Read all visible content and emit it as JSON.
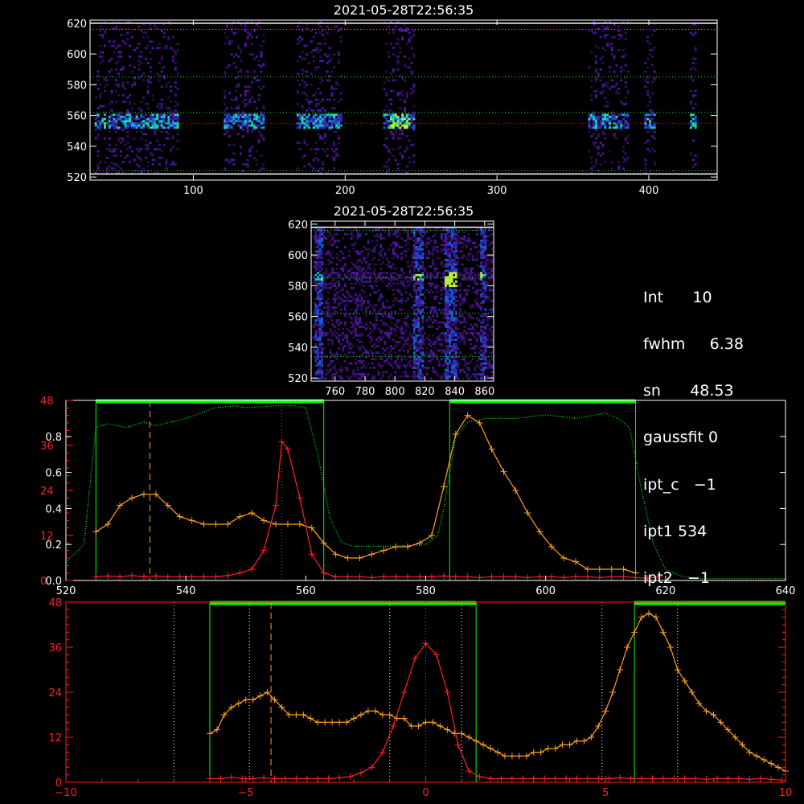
{
  "chart_data": [
    {
      "type": "heatmap",
      "title": "2021-05-28T22:56:35",
      "xlim": [
        32,
        445
      ],
      "ylim": [
        518,
        622
      ],
      "x_ticks": [
        100,
        200,
        300,
        400
      ],
      "y_ticks": [
        520,
        540,
        560,
        580,
        600,
        620
      ],
      "colors": {
        "frame": "#ffffff",
        "hline_dotted": "#00ff00",
        "hline_center": "#ff0000"
      },
      "hlines": [
        616,
        585,
        562,
        555,
        524
      ],
      "columns": [
        [
          35,
          90
        ],
        [
          120,
          147
        ],
        [
          168,
          197
        ],
        [
          225,
          245
        ],
        [
          360,
          387
        ],
        [
          397,
          404
        ],
        [
          427,
          431
        ]
      ]
    },
    {
      "type": "heatmap",
      "title": "2021-05-28T22:56:35",
      "xlim": [
        744,
        866
      ],
      "ylim": [
        518,
        622
      ],
      "x_ticks": [
        760,
        780,
        800,
        820,
        840,
        860
      ],
      "y_ticks": [
        520,
        540,
        560,
        580,
        600,
        620
      ],
      "hlines": [
        616,
        585,
        562,
        534
      ]
    },
    {
      "type": "line",
      "xlim": [
        520,
        640
      ],
      "ylim": [
        0,
        1
      ],
      "y2lim": [
        0,
        48
      ],
      "x_ticks": [
        520,
        540,
        560,
        580,
        600,
        620,
        640
      ],
      "y_ticks": [
        0.0,
        0.2,
        0.4,
        0.6,
        0.8
      ],
      "y_tick_labels": [
        "0.0",
        "0.2",
        "0.4",
        "0.6",
        "0.8"
      ],
      "y2_ticks": [
        0,
        12,
        24,
        36,
        48
      ],
      "windows": [
        [
          525,
          563
        ],
        [
          584,
          615
        ]
      ],
      "vlines": [
        534,
        556
      ],
      "series": [
        {
          "color": "#ff2020",
          "x": [
            525,
            527,
            529,
            531,
            533,
            535,
            537,
            539,
            541,
            543,
            545,
            547,
            549,
            551,
            553,
            555,
            556,
            557,
            559,
            561,
            563,
            565,
            567,
            569,
            571,
            573,
            575,
            577,
            579,
            581,
            583,
            585,
            587,
            589,
            591,
            593,
            595,
            597,
            599,
            601,
            603,
            605,
            607,
            609,
            611,
            613,
            615,
            617,
            619
          ],
          "y": [
            1,
            1.2,
            1,
            1.3,
            1,
            1.2,
            1,
            1,
            1,
            1,
            1,
            1.3,
            2,
            3,
            8,
            20,
            37,
            35,
            22,
            7,
            2,
            1,
            1,
            1,
            0.8,
            1,
            1,
            1,
            1,
            1,
            1.2,
            1,
            1,
            0.8,
            1,
            1,
            1,
            0.8,
            1,
            1,
            0.8,
            1,
            1,
            0.8,
            1,
            1,
            0.8,
            0.6,
            1
          ]
        },
        {
          "color": "#ffa020",
          "x": [
            525,
            527,
            529,
            531,
            533,
            535,
            537,
            539,
            541,
            543,
            545,
            547,
            549,
            551,
            553,
            555,
            557,
            559,
            561,
            563,
            565,
            567,
            569,
            571,
            573,
            575,
            577,
            579,
            581,
            583,
            585,
            587,
            589,
            591,
            593,
            595,
            597,
            599,
            601,
            603,
            605,
            607,
            609,
            611,
            613,
            615
          ],
          "y": [
            13,
            15,
            20,
            22,
            23,
            23,
            20,
            17,
            16,
            15,
            15,
            15,
            17,
            18,
            16,
            15,
            15,
            15,
            14,
            10,
            7,
            6,
            6,
            7,
            8,
            9,
            9,
            10,
            12,
            25,
            39,
            44,
            42,
            35,
            29,
            24,
            18,
            13,
            9,
            6,
            5,
            3,
            3,
            3,
            3,
            2
          ]
        },
        {
          "color": "#00ff00",
          "x": [
            520,
            523,
            525,
            527,
            530,
            533,
            535,
            540,
            545,
            548,
            550,
            555,
            558,
            560,
            562,
            564,
            566,
            568,
            570,
            575,
            580,
            582,
            583,
            584,
            585,
            587,
            590,
            595,
            600,
            605,
            610,
            612,
            614,
            616,
            618,
            620,
            623,
            626,
            630,
            635,
            640
          ],
          "y": [
            0.1,
            0.2,
            0.85,
            0.87,
            0.85,
            0.88,
            0.86,
            0.9,
            0.96,
            0.97,
            0.96,
            0.97,
            0.97,
            0.96,
            0.7,
            0.35,
            0.21,
            0.19,
            0.19,
            0.19,
            0.2,
            0.25,
            0.4,
            0.6,
            0.8,
            0.88,
            0.9,
            0.9,
            0.92,
            0.9,
            0.93,
            0.9,
            0.85,
            0.5,
            0.2,
            0.06,
            0.02,
            0.01,
            0.01,
            0.01,
            0.01
          ]
        }
      ]
    },
    {
      "type": "line",
      "xlim": [
        -10,
        10
      ],
      "ylim": [
        0,
        48
      ],
      "x_ticks": [
        -10,
        -5,
        0,
        5,
        10
      ],
      "y_ticks": [
        0,
        12,
        24,
        36,
        48
      ],
      "windows": [
        [
          -6.0,
          1.4
        ],
        [
          5.8,
          10
        ]
      ],
      "dotted_vlines": [
        -7.0,
        -4.9,
        -1.0,
        1.0,
        4.9,
        7.0
      ],
      "vlines": [
        -4.3,
        0
      ],
      "series": [
        {
          "color": "#ff2020",
          "x": [
            -6,
            -5.7,
            -5.4,
            -5.1,
            -4.8,
            -4.5,
            -4.2,
            -3.9,
            -3.6,
            -3.3,
            -3,
            -2.7,
            -2.4,
            -2.1,
            -1.8,
            -1.5,
            -1.2,
            -0.9,
            -0.6,
            -0.3,
            0,
            0.3,
            0.6,
            0.9,
            1.2,
            1.5,
            1.8,
            2.1,
            2.4,
            2.7,
            3,
            3.3,
            3.6,
            3.9,
            4.2,
            4.5,
            4.8,
            5.1,
            5.4,
            5.7,
            6,
            6.3,
            6.6,
            6.9,
            7.2,
            7.5,
            7.8,
            8.1,
            8.4,
            8.7,
            9,
            9.3,
            9.6,
            9.9
          ],
          "y": [
            1,
            1,
            1.3,
            1,
            1,
            1.2,
            1,
            1,
            1,
            1,
            1,
            1,
            1.2,
            1.5,
            2.5,
            4,
            8,
            15,
            24,
            33,
            37,
            34,
            24,
            10,
            3,
            1.5,
            1,
            1,
            1,
            1,
            1,
            1,
            1,
            1,
            1,
            1,
            1,
            1,
            1.2,
            1,
            1,
            1,
            1,
            1,
            1,
            1,
            0.8,
            1,
            1,
            1,
            0.8,
            1,
            0.8,
            0.6
          ]
        },
        {
          "color": "#ffa020",
          "x": [
            -6,
            -5.8,
            -5.6,
            -5.4,
            -5.2,
            -5,
            -4.8,
            -4.6,
            -4.4,
            -4.2,
            -4,
            -3.8,
            -3.6,
            -3.4,
            -3.2,
            -3,
            -2.8,
            -2.6,
            -2.4,
            -2.2,
            -2,
            -1.8,
            -1.6,
            -1.4,
            -1.2,
            -1,
            -0.8,
            -0.6,
            -0.4,
            -0.2,
            0,
            0.2,
            0.4,
            0.6,
            0.8,
            1,
            1.2,
            1.4,
            1.6,
            1.8,
            2,
            2.2,
            2.4,
            2.6,
            2.8,
            3,
            3.2,
            3.4,
            3.6,
            3.8,
            4,
            4.2,
            4.4,
            4.6,
            4.8,
            5,
            5.2,
            5.4,
            5.6,
            5.8,
            6,
            6.2,
            6.4,
            6.6,
            6.8,
            7,
            7.2,
            7.4,
            7.6,
            7.8,
            8,
            8.2,
            8.4,
            8.6,
            8.8,
            9,
            9.2,
            9.4,
            9.6,
            9.8,
            10
          ],
          "y": [
            13,
            14,
            18,
            20,
            21,
            22,
            22,
            23,
            24,
            22,
            20,
            18,
            18,
            18,
            17,
            16,
            16,
            16,
            16,
            16,
            17,
            18,
            19,
            19,
            18,
            18,
            17,
            17,
            15,
            15,
            16,
            16,
            15,
            14,
            13,
            13,
            12,
            11,
            10,
            9,
            8,
            7,
            7,
            7,
            7,
            8,
            8,
            9,
            9,
            10,
            10,
            11,
            11,
            12,
            15,
            19,
            24,
            30,
            36,
            40,
            44,
            45,
            44,
            40,
            36,
            30,
            27,
            24,
            21,
            19,
            18,
            16,
            14,
            12,
            10,
            8,
            7,
            6,
            5,
            4,
            3
          ]
        }
      ]
    }
  ],
  "info": [
    {
      "label": "Int",
      "value": "10"
    },
    {
      "label": "fwhm",
      "value": "6.38"
    },
    {
      "label": "sn",
      "value": "48.53"
    },
    {
      "label": "gaussfit",
      "value": "0"
    },
    {
      "label": "ipt_c",
      "value": "−1"
    },
    {
      "label": "ipt1",
      "value": "534"
    },
    {
      "label": "ipt2",
      "value": "−1"
    }
  ]
}
